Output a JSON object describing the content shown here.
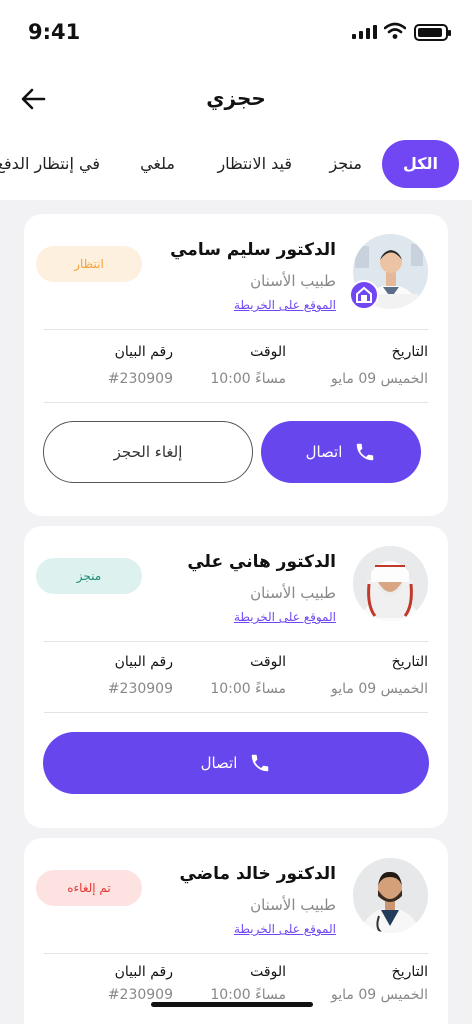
{
  "status_bar": {
    "time": "9:41"
  },
  "header": {
    "title": "حجزي"
  },
  "tabs": [
    {
      "label": "الكل",
      "active": true
    },
    {
      "label": "منجز"
    },
    {
      "label": "قيد الانتظار"
    },
    {
      "label": "ملغي"
    },
    {
      "label": "في إنتظار الدفع"
    }
  ],
  "info_labels": {
    "date": "التاريخ",
    "time": "الوقت",
    "statement": "رقم البيان"
  },
  "colors": {
    "accent": "#7047f3",
    "pending": "#f2a33a",
    "done": "#1e8a78",
    "cancelled": "#e53935"
  },
  "appointments": [
    {
      "doctor": "الدكتور سليم سامي",
      "specialty": "طبيب الأسنان",
      "map_link": "الموقع على الخريطة",
      "status": "انتظار",
      "date": "الخميس 09 مايو",
      "time": "10:00 مساءً",
      "number": "#230909",
      "call_label": "اتصال",
      "cancel_label": "إلغاء الحجز"
    },
    {
      "doctor": "الدكتور هاني علي",
      "specialty": "طبيب الأسنان",
      "map_link": "الموقع على الخريطة",
      "status": "منجز",
      "date": "الخميس 09 مايو",
      "time": "10:00 مساءً",
      "number": "#230909",
      "call_label": "اتصال"
    },
    {
      "doctor": "الدكتور خالد ماضي",
      "specialty": "طبيب الأسنان",
      "map_link": "الموقع على الخريطة",
      "status": "تم إلغاءه",
      "date": "الخميس 09 مايو",
      "time": "10:00 مساءً",
      "number": "#230909"
    }
  ]
}
